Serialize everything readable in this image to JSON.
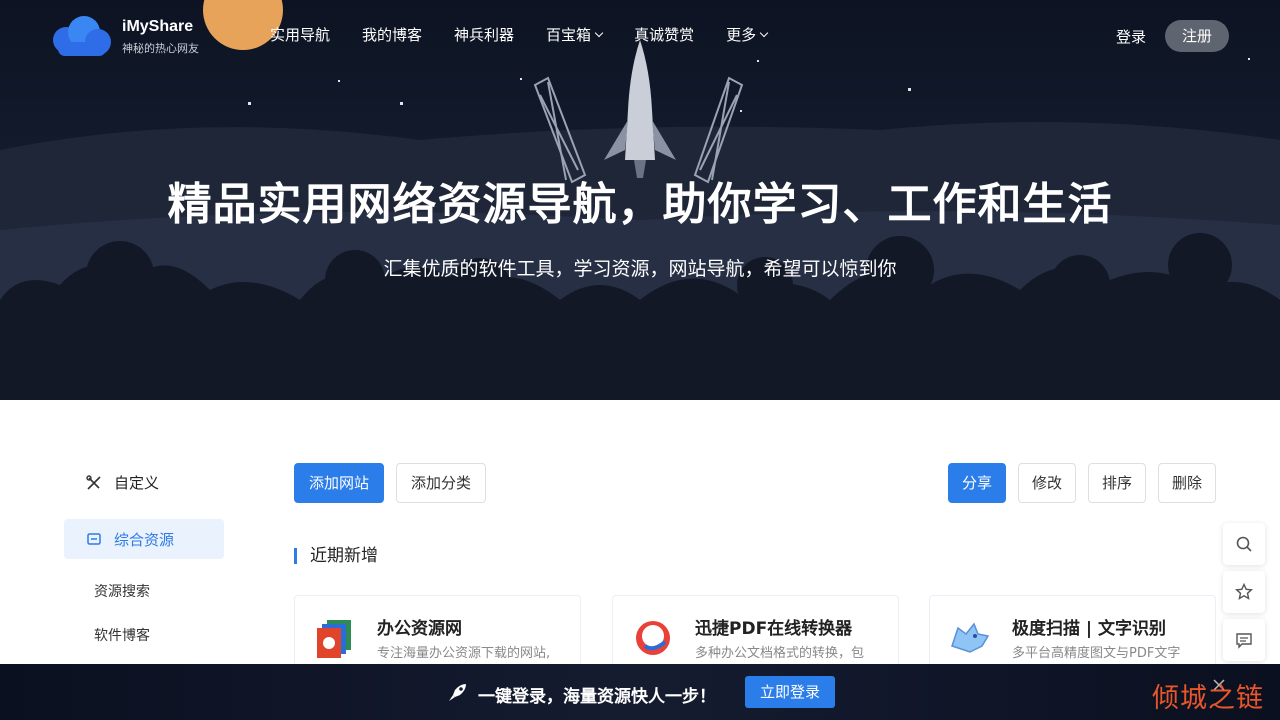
{
  "brand": {
    "name": "iMyShare",
    "tagline": "神秘的热心网友"
  },
  "nav": {
    "items": [
      {
        "label": "实用导航"
      },
      {
        "label": "我的博客"
      },
      {
        "label": "神兵利器"
      },
      {
        "label": "百宝箱"
      },
      {
        "label": "真诚赞赏"
      },
      {
        "label": "更多"
      }
    ],
    "login": "登录",
    "register": "注册"
  },
  "hero": {
    "title": "精品实用网络资源导航，助你学习、工作和生活",
    "subtitle": "汇集优质的软件工具，学习资源，网站导航，希望可以惊到你"
  },
  "sidebar": {
    "custom": "自定义",
    "active": "综合资源",
    "subs": [
      "资源搜索",
      "软件博客"
    ]
  },
  "toolbar": {
    "add_site": "添加网站",
    "add_category": "添加分类",
    "share": "分享",
    "edit": "修改",
    "sort": "排序",
    "delete": "删除"
  },
  "section": {
    "title": "近期新增"
  },
  "cards": [
    {
      "title": "办公资源网",
      "desc": "专注海量办公资源下载的网站,"
    },
    {
      "title": "迅捷PDF在线转换器",
      "desc": "多种办公文档格式的转换，包"
    },
    {
      "title": "极度扫描 | 文字识别",
      "desc": "多平台高精度图文与PDF文字"
    }
  ],
  "bottom_bar": {
    "text": "一键登录，海量资源快人一步！",
    "button": "立即登录"
  },
  "watermark": "倾城之链",
  "colors": {
    "primary": "#2b7de9",
    "active_bg": "#e9f2fd",
    "watermark": "#e8562a"
  }
}
